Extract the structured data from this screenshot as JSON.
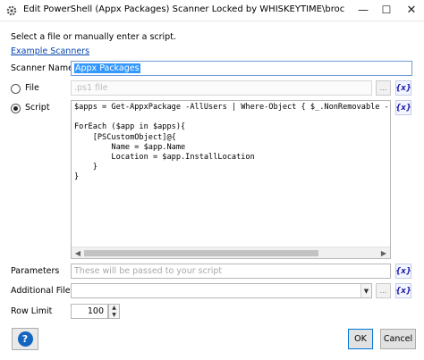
{
  "window": {
    "title": "Edit PowerShell (Appx Packages) Scanner Locked by WHISKEYTIME\\brock.bingham on...",
    "controls": {
      "minimize": "—",
      "maximize": "☐",
      "close": "✕"
    }
  },
  "instructions": "Select a file or manually enter a script.",
  "example_link": "Example Scanners",
  "scanner_name": {
    "label": "Scanner Name",
    "value": "Appx Packages"
  },
  "source": {
    "file": {
      "label": "File",
      "placeholder": ".ps1 file",
      "selected": false
    },
    "script": {
      "label": "Script",
      "selected": true,
      "code": "$apps = Get-AppxPackage -AllUsers | Where-Object { $_.NonRemovable -e\n\nForEach ($app in $apps){\n    [PSCustomObject]@{\n        Name = $app.Name\n        Location = $app.InstallLocation\n    }\n}"
    }
  },
  "parameters": {
    "label": "Parameters",
    "placeholder": "These will be passed to your script"
  },
  "additional_files": {
    "label": "Additional Files",
    "value": ""
  },
  "row_limit": {
    "label": "Row Limit",
    "value": "100"
  },
  "buttons": {
    "browse": "...",
    "variable": "{x}",
    "help": "?",
    "ok": "OK",
    "cancel": "Cancel"
  },
  "icons": {
    "app": "gear-icon",
    "variable": "variable-icon",
    "help": "help-icon",
    "dropdown": "chevron-down-icon"
  },
  "colors": {
    "accent": "#0078d7",
    "link": "#0645ad",
    "help": "#1565c0",
    "selection": "#3399ff"
  }
}
